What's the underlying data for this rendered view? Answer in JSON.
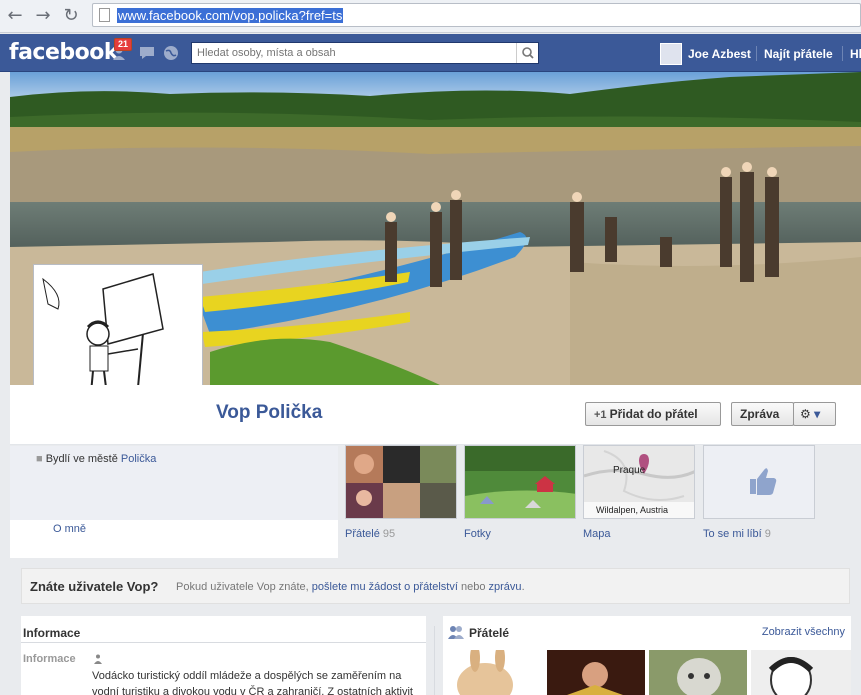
{
  "browser": {
    "url": "www.facebook.com/vop.policka?fref=ts",
    "back_icon": "←",
    "forward_icon": "→",
    "reload_icon": "↻"
  },
  "header": {
    "logo": "facebook",
    "friend_requests_badge": "21",
    "search_placeholder": "Hledat osoby, místa a obsah",
    "user_name": "Joe Azbest",
    "find_friends": "Najít přátele",
    "home_truncated": "Hl"
  },
  "profile": {
    "name": "Vop Polička",
    "add_friend_label": "Přidat do přátel",
    "message_label": "Zpráva",
    "lives_in_prefix": "Bydlí ve městě",
    "lives_in_city": "Polička",
    "about_link": "O mně"
  },
  "apps": [
    {
      "label": "Přátelé",
      "count": "95"
    },
    {
      "label": "Fotky",
      "count": ""
    },
    {
      "label": "Mapa",
      "count": ""
    },
    {
      "label": "To se mi líbí",
      "count": "9"
    }
  ],
  "map": {
    "city": "Praque",
    "caption": "Wildalpen, Austria"
  },
  "know_box": {
    "title": "Znáte uživatele Vop?",
    "text_prefix": "Pokud uživatele Vop znáte,",
    "link_request": "pošlete mu žádost o přátelství",
    "text_mid": "nebo",
    "link_message": "zprávu",
    "text_end": "."
  },
  "info_section": {
    "title": "Informace",
    "key": "Informace",
    "description": "Vodácko turistický oddíl mládeže a dospělých se zaměřením na vodní turistiku a divokou vodu v ČR a zahraničí. Z ostatních aktivit pěší"
  },
  "friends_section": {
    "title": "Přátelé",
    "see_all": "Zobrazit všechny"
  },
  "colors": {
    "fb_blue": "#3b5998",
    "link": "#3b5998",
    "badge_red": "#e53c3c"
  }
}
